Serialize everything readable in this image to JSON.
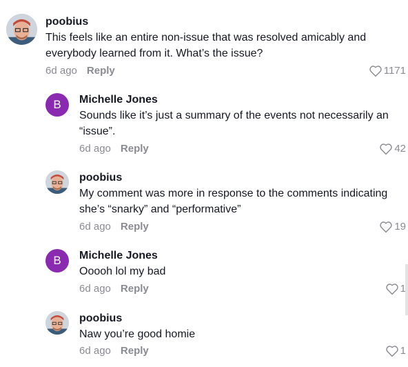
{
  "comments": [
    {
      "username": "poobius",
      "avatar": "photo",
      "text": "This feels like an entire non-issue that was resolved amicably and everybody learned from it. What’s the issue?",
      "time": "6d ago",
      "reply_label": "Reply",
      "likes": "1171",
      "like_icon": "heart-outline-icon"
    },
    {
      "username": "Michelle Jones",
      "avatar": "letter",
      "avatar_letter": "B",
      "avatar_color": "#8a2ab0",
      "text": "Sounds like it’s just a summary of the events not necessarily an “issue”.",
      "time": "6d ago",
      "reply_label": "Reply",
      "likes": "42",
      "like_icon": "heart-outline-icon"
    },
    {
      "username": "poobius",
      "avatar": "photo",
      "text": "My comment was more in response to the comments indicating she’s “snarky” and “performative”",
      "time": "6d ago",
      "reply_label": "Reply",
      "likes": "19",
      "like_icon": "heart-outline-icon"
    },
    {
      "username": "Michelle Jones",
      "avatar": "letter",
      "avatar_letter": "B",
      "avatar_color": "#8a2ab0",
      "text": "Ooooh lol my bad",
      "time": "6d ago",
      "reply_label": "Reply",
      "likes": "1",
      "like_icon": "heart-outline-icon"
    },
    {
      "username": "poobius",
      "avatar": "photo",
      "text": "Naw you’re good homie",
      "time": "6d ago",
      "reply_label": "Reply",
      "likes": "1",
      "like_icon": "heart-outline-icon"
    }
  ]
}
